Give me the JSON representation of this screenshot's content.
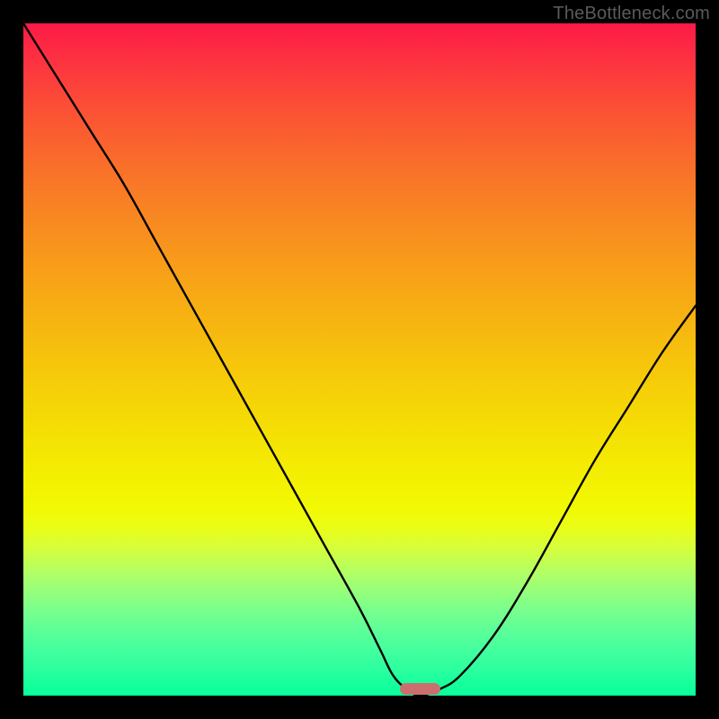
{
  "attribution": "TheBottleneck.com",
  "chart_data": {
    "type": "line",
    "title": "",
    "xlabel": "",
    "ylabel": "",
    "xlim": [
      0,
      100
    ],
    "ylim": [
      0,
      100
    ],
    "series": [
      {
        "name": "bottleneck-curve",
        "x": [
          0,
          5,
          10,
          15,
          20,
          25,
          30,
          35,
          40,
          45,
          50,
          53,
          55,
          57,
          59,
          62,
          65,
          70,
          75,
          80,
          85,
          90,
          95,
          100
        ],
        "values": [
          100,
          92,
          84,
          76,
          67,
          58,
          49,
          40,
          31,
          22,
          13,
          7,
          3,
          1,
          0,
          1,
          3,
          9,
          17,
          26,
          35,
          43,
          51,
          58
        ]
      }
    ],
    "annotations": [
      {
        "name": "optimal-marker",
        "x": 59,
        "y": 0,
        "width": 6
      }
    ],
    "gradient_colors": {
      "top": "#fd1a47",
      "mid_upper": "#f8911e",
      "mid": "#f5db05",
      "mid_lower": "#9aff78",
      "bottom": "#0aff9a"
    }
  }
}
